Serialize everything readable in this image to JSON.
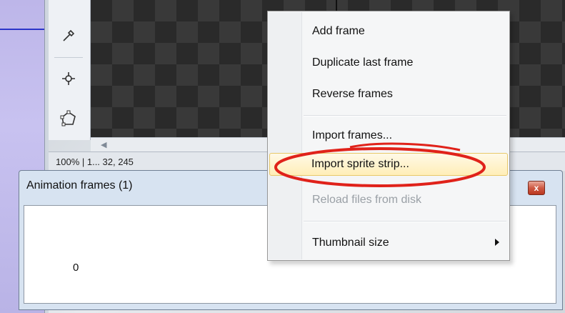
{
  "menu": {
    "items": [
      {
        "label": "Add frame",
        "disabled": false
      },
      {
        "label": "Duplicate last frame",
        "disabled": false
      },
      {
        "label": "Reverse frames",
        "disabled": false
      },
      {
        "label": "Import frames...",
        "disabled": false
      },
      {
        "label": "Import sprite strip...",
        "disabled": false,
        "highlighted": true
      },
      {
        "label": "Reload files from disk",
        "disabled": true
      },
      {
        "label": "Thumbnail size",
        "disabled": false,
        "has_submenu": true
      }
    ]
  },
  "status_bar": {
    "text": "100% | 1... 32, 245"
  },
  "animation_window": {
    "title": "Animation frames (1)",
    "close_label": "x",
    "frames": [
      {
        "index": "0"
      }
    ]
  },
  "tools": [
    "eyedropper-icon",
    "crosshair-icon",
    "polygon-select-icon"
  ],
  "colors": {
    "highlight_ellipse": "#e0221a",
    "menu_hover": "#ffeeb8",
    "left_line": "#2c35c9"
  }
}
